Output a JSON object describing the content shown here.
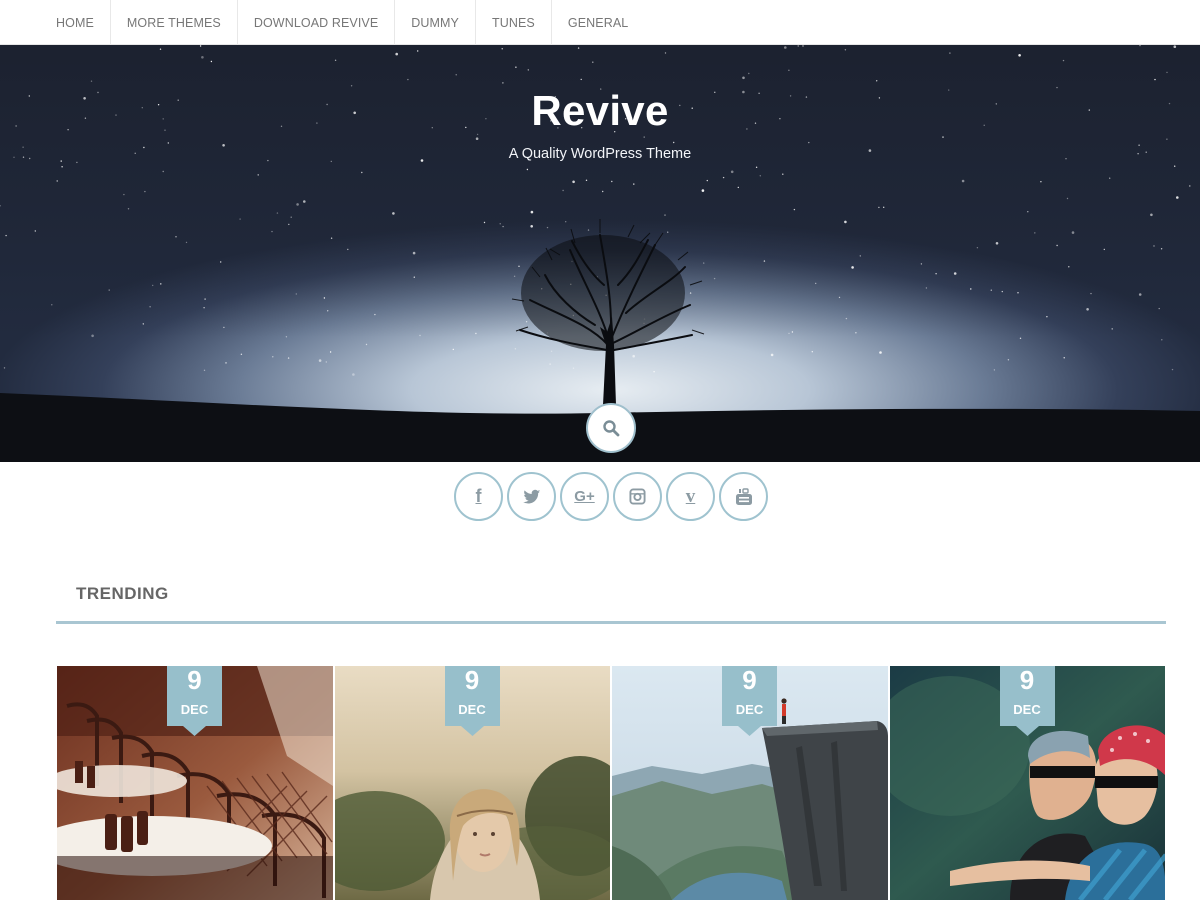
{
  "nav": {
    "items": [
      {
        "label": "HOME"
      },
      {
        "label": "MORE THEMES"
      },
      {
        "label": "DOWNLOAD REVIVE"
      },
      {
        "label": "DUMMY"
      },
      {
        "label": "TUNES"
      },
      {
        "label": "GENERAL"
      }
    ]
  },
  "hero": {
    "title": "Revive",
    "tagline": "A Quality WordPress Theme",
    "search_icon": "search-icon"
  },
  "social": [
    {
      "icon": "facebook-icon",
      "glyph": "f"
    },
    {
      "icon": "twitter-icon",
      "glyph": ""
    },
    {
      "icon": "google-plus-icon",
      "glyph": "G+"
    },
    {
      "icon": "instagram-icon",
      "glyph": ""
    },
    {
      "icon": "vine-icon",
      "glyph": "v"
    },
    {
      "icon": "youtube-icon",
      "glyph": ""
    }
  ],
  "trending": {
    "heading": "TRENDING",
    "posts": [
      {
        "day": "9",
        "month": "DEC",
        "image": "cafe-chairs"
      },
      {
        "day": "9",
        "month": "DEC",
        "image": "woman-portrait"
      },
      {
        "day": "9",
        "month": "DEC",
        "image": "cliff-fjord"
      },
      {
        "day": "9",
        "month": "DEC",
        "image": "couple-sunglasses"
      }
    ]
  },
  "colors": {
    "accent": "#9fc3cf",
    "flag": "#97bfcb",
    "nav_text": "#777777"
  }
}
